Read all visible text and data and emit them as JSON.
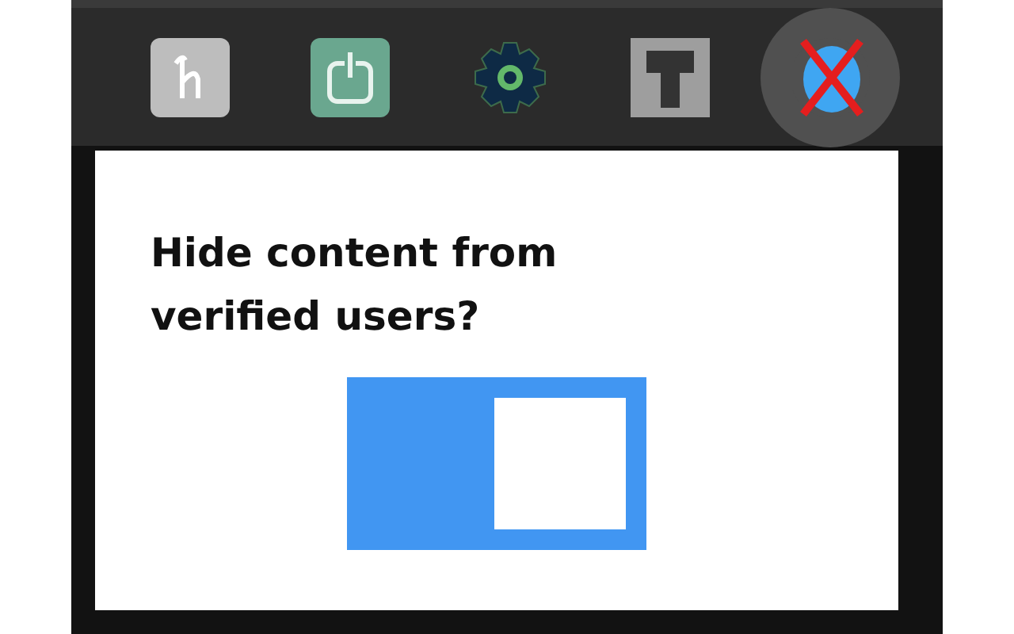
{
  "toolbar": {
    "extensions": [
      {
        "kind": "letter-tile",
        "selected": false
      },
      {
        "kind": "power-tile",
        "selected": false
      },
      {
        "kind": "gear",
        "selected": false
      },
      {
        "kind": "t-tile",
        "selected": false
      },
      {
        "kind": "crossed-blob",
        "selected": true
      }
    ]
  },
  "popup": {
    "question": "Hide content from verified users?",
    "toggle": {
      "on": true
    }
  }
}
